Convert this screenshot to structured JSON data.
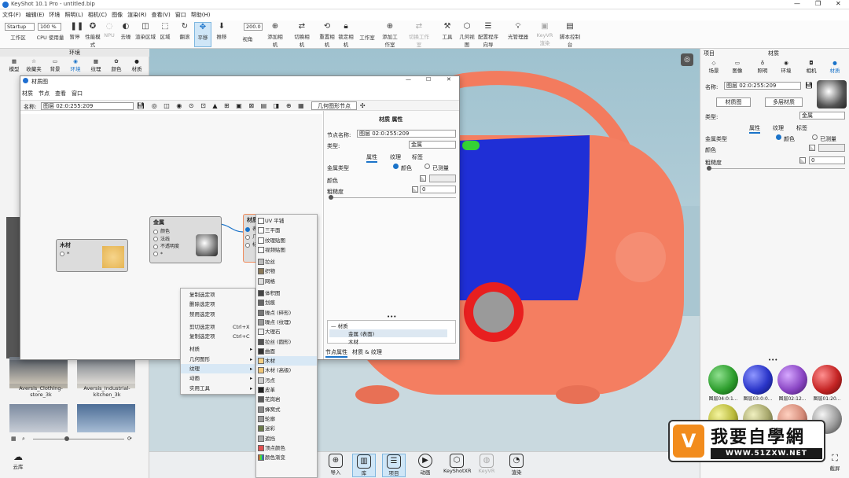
{
  "window": {
    "title": "KeyShot 10.1 Pro  -  untitled.bip"
  },
  "menubar": [
    "文件(F)",
    "编辑(E)",
    "环境",
    "照明(L)",
    "相机(C)",
    "图像",
    "渲染(R)",
    "查看(V)",
    "窗口",
    "帮助(H)"
  ],
  "toolbar": {
    "workspace_select": "Startup",
    "zoom_select": "100 %",
    "focal_value": "200.0",
    "items": [
      "工作区",
      "CPU 使用量",
      "暂停",
      "性能模式",
      "NPU",
      "去噪",
      "渲染区域",
      "区域",
      "翻滚",
      "平移",
      "推移",
      "视角",
      "添加相机",
      "切换相机",
      "重置相机",
      "锁定相机",
      "工作室",
      "添加工作室",
      "切换工作室",
      "工具",
      "几何视图",
      "配置程序向导",
      "光管理器",
      "KeyVR 渲染",
      "脚本控制台"
    ]
  },
  "left_panel": {
    "header": "环境",
    "tabs": [
      "模型",
      "收藏夹",
      "背景",
      "环境",
      "纹理",
      "颜色",
      "材质"
    ],
    "thumbs": [
      {
        "label": "Aversis_Clothing-store_3k"
      },
      {
        "label": "Aversis_Industrial-kitchen_3k"
      }
    ],
    "bottom_label": "云库"
  },
  "material_window": {
    "title": "材质图",
    "menu": [
      "材质",
      "节点",
      "查看",
      "窗口"
    ],
    "name_label": "名称:",
    "name_value": "图层 02:0:255:209",
    "geo_node_button": "几何图形节点",
    "nodes": {
      "wood": {
        "title": "木材",
        "port": "*"
      },
      "metal": {
        "title": "金属",
        "ports": [
          "颜色",
          "法线",
          "不透明度",
          "*"
        ]
      },
      "mat": {
        "title": "材质",
        "ports": [
          "表面",
          "几何",
          "标签"
        ]
      }
    }
  },
  "context_menu": {
    "items": [
      {
        "label": "复制选定项"
      },
      {
        "label": "删除选定项"
      },
      {
        "label": "禁用选定项"
      },
      {
        "label": "剪切选定项",
        "shortcut": "Ctrl+X"
      },
      {
        "label": "复制选定项",
        "shortcut": "Ctrl+C"
      },
      {
        "label": "材质",
        "sub": true
      },
      {
        "label": "几何图形",
        "sub": true
      },
      {
        "label": "纹理",
        "sub": true
      },
      {
        "label": "动画",
        "sub": true
      },
      {
        "label": "实用工具",
        "sub": true
      }
    ]
  },
  "texture_submenu": {
    "items": [
      "UV 平铺",
      "三平面",
      "纹理贴图",
      "视频贴图",
      "拉丝",
      "织物",
      "网格",
      "体积图",
      "划痕",
      "噪点 (碎形)",
      "噪点 (纹理)",
      "大理石",
      "拉丝 (圆形)",
      "曲面",
      "木材",
      "木材 (高级)",
      "污点",
      "皮革",
      "花岗岩",
      "蜂窝式",
      "轮廓",
      "迷彩",
      "遮挡",
      "顶点颜色",
      "颜色渐变"
    ]
  },
  "props_panel": {
    "header": "材质 属性",
    "node_name_label": "节点名称:",
    "node_name_value": "图层 02:0:255:209",
    "type_label": "类型:",
    "type_value": "金属",
    "tabs": [
      "属性",
      "纹理",
      "标签"
    ],
    "metal_type_label": "金属类型",
    "radio1": "颜色",
    "radio2": "已测量",
    "color_label": "颜色",
    "roughness_label": "粗糙度",
    "roughness_value": "0",
    "tree_root": "材质",
    "tree_child": "金属 (表面)",
    "tree_child2": "木材",
    "bottom_tabs": [
      "节点属性",
      "材质 & 纹理"
    ]
  },
  "right_panel": {
    "header": "项目",
    "header2": "材质",
    "tabs": [
      "场景",
      "图像",
      "照明",
      "环境",
      "相机",
      "材质"
    ],
    "name_label": "名称:",
    "name_value": "图层 02:0:255:209",
    "btn_graph": "材质图",
    "btn_multi": "多层材质",
    "type_label": "类型:",
    "type_value": "金属",
    "subtabs": [
      "属性",
      "纹理",
      "标签"
    ],
    "metal_type_label": "金属类型",
    "radio1": "颜色",
    "radio2": "已测量",
    "color_label": "颜色",
    "roughness_label": "粗糙度",
    "roughness_value": "0",
    "swatches": [
      {
        "label": "图层04:0:1...",
        "color": "#2e9e2e"
      },
      {
        "label": "图层03:0:0...",
        "color": "#2a35c9"
      },
      {
        "label": "图层02:12...",
        "color": "#8a46c4"
      },
      {
        "label": "图层01:20...",
        "color": "#c42424"
      }
    ],
    "capture_label": "截屏"
  },
  "bottom_bar": [
    "导入",
    "库",
    "项目",
    "动画",
    "KeyShotXR",
    "KeyVR",
    "渲染"
  ],
  "watermark": {
    "text": "我要自學網",
    "url": "WWW.51ZXW.NET"
  }
}
